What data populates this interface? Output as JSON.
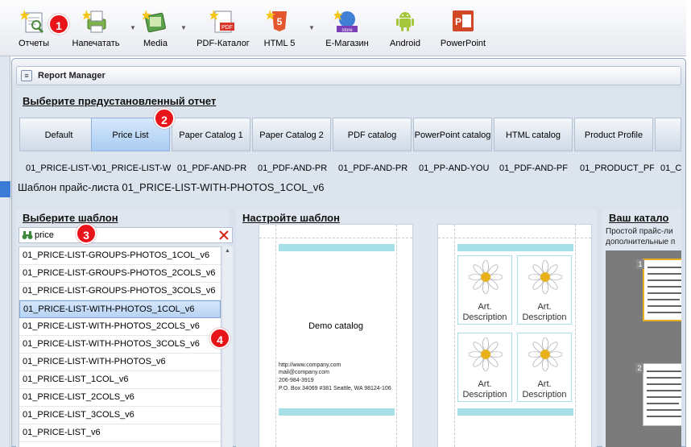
{
  "toolbar": {
    "buttons": [
      {
        "label": "Отчеты",
        "icon": "reports-icon"
      },
      {
        "label": "Напечатать",
        "icon": "print-icon"
      },
      {
        "label": "Media",
        "icon": "media-icon"
      },
      {
        "label": "PDF-Каталог",
        "icon": "pdf-icon"
      },
      {
        "label": "HTML 5",
        "icon": "html5-icon"
      },
      {
        "label": "E-Магазин",
        "icon": "estore-icon"
      },
      {
        "label": "Android",
        "icon": "android-icon"
      },
      {
        "label": "PowerPoint",
        "icon": "powerpoint-icon"
      }
    ]
  },
  "badges": [
    "1",
    "2",
    "3",
    "4"
  ],
  "window": {
    "title": "Report Manager",
    "preset_title": "Выберите предустановленный отчет",
    "tabs": [
      "Default",
      "Price List",
      "Paper Catalog 1",
      "Paper Catalog 2",
      "PDF catalog",
      "PowerPoint catalog",
      "HTML catalog",
      "Product Profile"
    ],
    "active_tab": "Price List",
    "report_names": [
      "01_PRICE-LIST-V",
      "01_PRICE-LIST-W",
      "01_PDF-AND-PR",
      "01_PDF-AND-PR",
      "01_PDF-AND-PR",
      "01_PP-AND-YOU",
      "01_PDF-AND-PF",
      "01_PRODUCT_PF",
      "01_C"
    ],
    "template_description": "Шаблон прайс-листа 01_PRICE-LIST-WITH-PHOTOS_1COL_v6"
  },
  "left_panel": {
    "title": "Выберите шаблон",
    "search_value": "price",
    "items": [
      "01_PRICE-LIST-GROUPS-PHOTOS_1COL_v6",
      "01_PRICE-LIST-GROUPS-PHOTOS_2COLS_v6",
      "01_PRICE-LIST-GROUPS-PHOTOS_3COLS_v6",
      "01_PRICE-LIST-WITH-PHOTOS_1COL_v6",
      "01_PRICE-LIST-WITH-PHOTOS_2COLS_v6",
      "01_PRICE-LIST-WITH-PHOTOS_3COLS_v6",
      "01_PRICE-LIST-WITH-PHOTOS_v6",
      "01_PRICE-LIST_1COL_v6",
      "01_PRICE-LIST_2COLS_v6",
      "01_PRICE-LIST_3COLS_v6",
      "01_PRICE-LIST_v6"
    ],
    "selected_item": "01_PRICE-LIST-WITH-PHOTOS_1COL_v6"
  },
  "mid_panel": {
    "title": "Настройте шаблон",
    "demo_text": "Demo catalog",
    "contact": [
      "http://www.company.com",
      "mail@company.com",
      "206-984-3919",
      "P.O. Box 34069 #381 Seattle, WA 98124-106"
    ],
    "card_line1": "Art.",
    "card_line2": "Description"
  },
  "right_panel": {
    "title": "Ваш катало",
    "description_line1": "Простой прайс-ли",
    "description_line2": "дополнительные п",
    "thumb_numbers": [
      "1",
      "2"
    ]
  },
  "colors": {
    "badge": "#e8141a",
    "selection": "#b7d3f3",
    "accent_cyan": "#a6dfe6"
  }
}
